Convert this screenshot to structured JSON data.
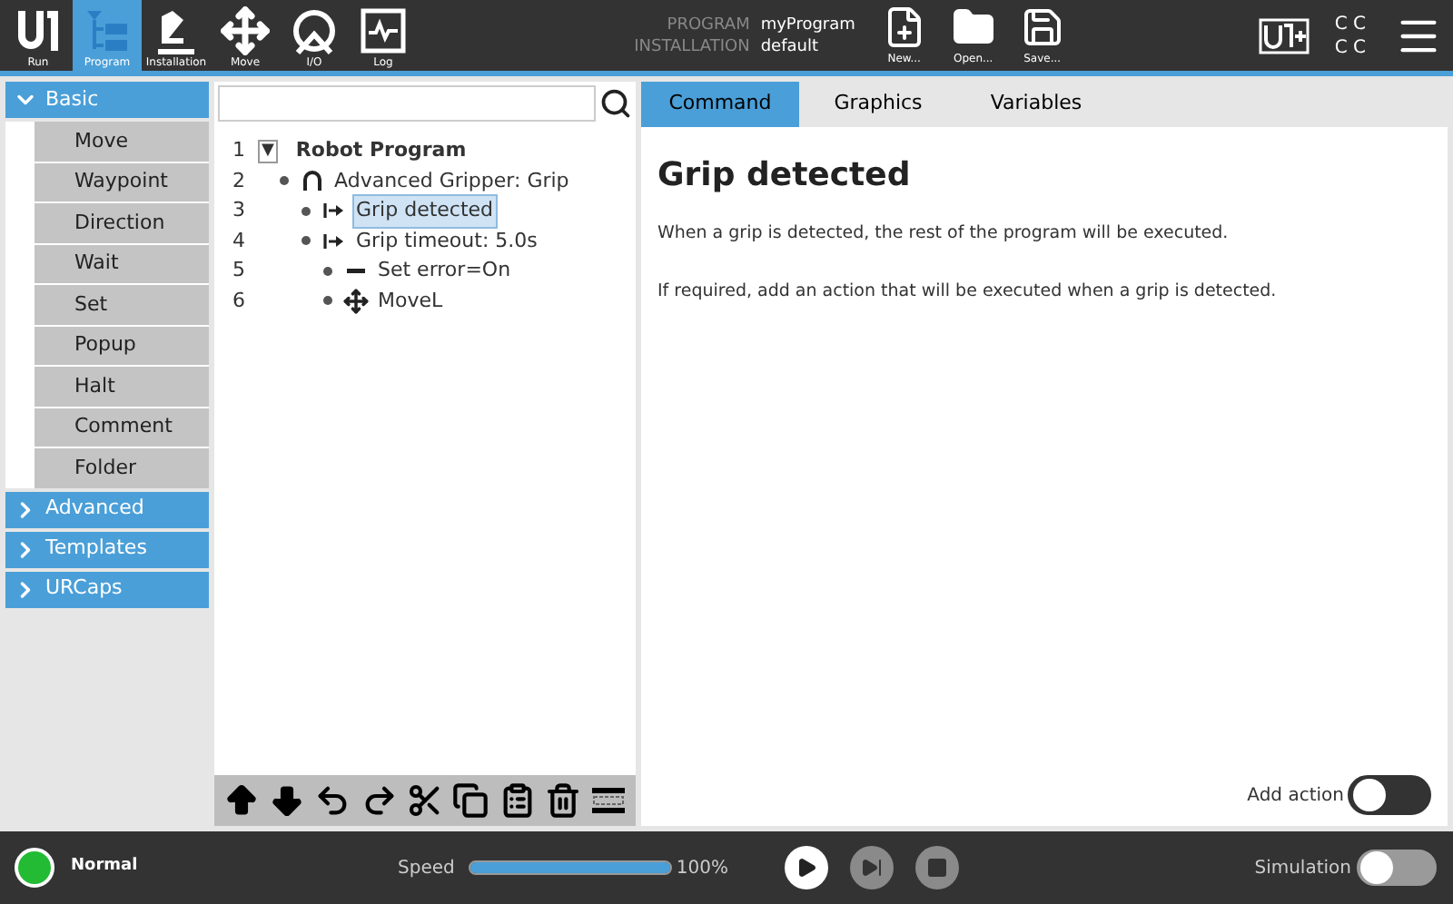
{
  "top_bar": {
    "tabs": [
      {
        "label": "Run",
        "selected": false
      },
      {
        "label": "Program",
        "selected": true
      },
      {
        "label": "Installation",
        "selected": false
      },
      {
        "label": "Move",
        "selected": false
      },
      {
        "label": "I/O",
        "selected": false
      },
      {
        "label": "Log",
        "selected": false
      }
    ],
    "program_label": "PROGRAM",
    "program_name": "myProgram",
    "installation_label": "INSTALLATION",
    "installation_name": "default",
    "file_buttons": [
      {
        "label": "New..."
      },
      {
        "label": "Open..."
      },
      {
        "label": "Save..."
      }
    ],
    "status_letters": [
      "C C",
      "C C"
    ]
  },
  "sidebar": {
    "groups": [
      {
        "label": "Basic",
        "expanded": true,
        "items": [
          "Move",
          "Waypoint",
          "Direction",
          "Wait",
          "Set",
          "Popup",
          "Halt",
          "Comment",
          "Folder"
        ]
      },
      {
        "label": "Advanced",
        "expanded": false
      },
      {
        "label": "Templates",
        "expanded": false
      },
      {
        "label": "URCaps",
        "expanded": false
      }
    ]
  },
  "tree": {
    "nodes": [
      {
        "line": "1",
        "label": "Robot Program",
        "toggle": "▼",
        "kind": "root",
        "selected": false,
        "children": [
          {
            "line": "2",
            "label": "Advanced Gripper: Grip",
            "kind": "gripper",
            "selected": false,
            "children": [
              {
                "line": "3",
                "label": "Grip detected",
                "kind": "branch",
                "selected": true
              },
              {
                "line": "4",
                "label": "Grip timeout: 5.0s",
                "kind": "branch",
                "selected": false,
                "children": [
                  {
                    "line": "5",
                    "label": "Set error=On",
                    "kind": "set",
                    "selected": false
                  },
                  {
                    "line": "6",
                    "label": "MoveL",
                    "kind": "move",
                    "selected": false
                  }
                ]
              }
            ]
          }
        ]
      }
    ]
  },
  "command_panel": {
    "tabs": [
      {
        "label": "Command",
        "selected": true
      },
      {
        "label": "Graphics",
        "selected": false
      },
      {
        "label": "Variables",
        "selected": false
      }
    ],
    "title": "Grip detected",
    "paragraphs": [
      "When a grip is detected, the rest of the program will be executed.",
      "If required, add an action that will be executed when a grip is detected."
    ],
    "add_action": {
      "label": "Add action",
      "on": false
    }
  },
  "bottom_bar": {
    "status": "Normal",
    "speed": {
      "label": "Speed",
      "level": 1,
      "reading": "100%"
    },
    "controls": [
      {
        "kind": "play",
        "disabled": false
      },
      {
        "kind": "step",
        "disabled": true
      },
      {
        "kind": "stop",
        "disabled": true
      }
    ],
    "simulation": {
      "label": "Simulation",
      "on": false
    }
  }
}
